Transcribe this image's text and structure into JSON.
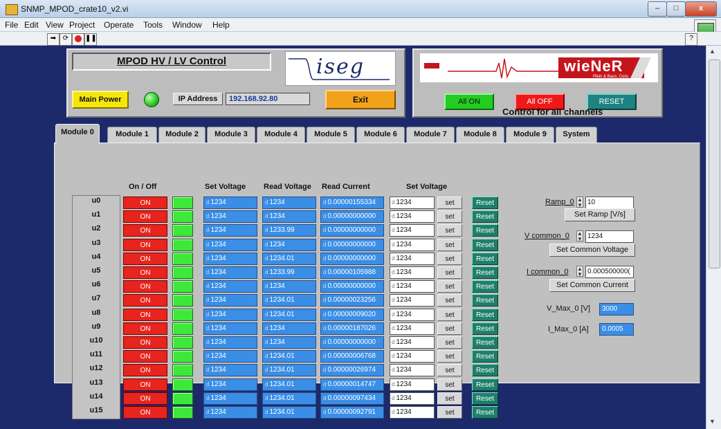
{
  "window": {
    "title": "SNMP_MPOD_crate10_v2.vi",
    "min": "–",
    "max": "□",
    "close": "x"
  },
  "menu": [
    "File",
    "Edit",
    "View",
    "Project",
    "Operate",
    "Tools",
    "Window",
    "Help"
  ],
  "toolbar": {
    "help": "?"
  },
  "header": {
    "title": "MPOD HV / LV Control",
    "iseg_logo": "iseg",
    "main_power": "Main Power",
    "ip_label": "IP Address",
    "ip_value": "192.168.92.80",
    "exit": "Exit"
  },
  "wiener": {
    "logo": "wieNeR",
    "sub": "Plein & Baus, Corp.",
    "all_on": "All ON",
    "all_off": "All OFF",
    "reset": "RESET",
    "caption": "Control for all channels"
  },
  "tabs": [
    "Module 0",
    "Module 1",
    "Module 2",
    "Module 3",
    "Module 4",
    "Module 5",
    "Module 6",
    "Module 7",
    "Module 8",
    "Module 9",
    "System"
  ],
  "columns": {
    "onoff": "On / Off",
    "set_voltage": "Set Voltage",
    "read_voltage": "Read Voltage",
    "read_current": "Read Current",
    "set_voltage2": "Set Voltage"
  },
  "channels": [
    {
      "name": "u0",
      "on": "ON",
      "set": "1234",
      "readv": "1234",
      "readi": "0.00000155334",
      "ctl": "1234",
      "setbtn": "set",
      "reset": "Reset"
    },
    {
      "name": "u1",
      "on": "ON",
      "set": "1234",
      "readv": "1234",
      "readi": "0.00000000000",
      "ctl": "1234",
      "setbtn": "set",
      "reset": "Reset"
    },
    {
      "name": "u2",
      "on": "ON",
      "set": "1234",
      "readv": "1233.99",
      "readi": "0.00000000000",
      "ctl": "1234",
      "setbtn": "set",
      "reset": "Reset"
    },
    {
      "name": "u3",
      "on": "ON",
      "set": "1234",
      "readv": "1234",
      "readi": "0.00000000000",
      "ctl": "1234",
      "setbtn": "set",
      "reset": "Reset"
    },
    {
      "name": "u4",
      "on": "ON",
      "set": "1234",
      "readv": "1234.01",
      "readi": "0.00000000000",
      "ctl": "1234",
      "setbtn": "set",
      "reset": "Reset"
    },
    {
      "name": "u5",
      "on": "ON",
      "set": "1234",
      "readv": "1233.99",
      "readi": "0.00000105988",
      "ctl": "1234",
      "setbtn": "set",
      "reset": "Reset"
    },
    {
      "name": "u6",
      "on": "ON",
      "set": "1234",
      "readv": "1234",
      "readi": "0.00000000000",
      "ctl": "1234",
      "setbtn": "set",
      "reset": "Reset"
    },
    {
      "name": "u7",
      "on": "ON",
      "set": "1234",
      "readv": "1234.01",
      "readi": "0.00000023256",
      "ctl": "1234",
      "setbtn": "set",
      "reset": "Reset"
    },
    {
      "name": "u8",
      "on": "ON",
      "set": "1234",
      "readv": "1234.01",
      "readi": "0.00000009020",
      "ctl": "1234",
      "setbtn": "set",
      "reset": "Reset"
    },
    {
      "name": "u9",
      "on": "ON",
      "set": "1234",
      "readv": "1234",
      "readi": "0.00000187026",
      "ctl": "1234",
      "setbtn": "set",
      "reset": "Reset"
    },
    {
      "name": "u10",
      "on": "ON",
      "set": "1234",
      "readv": "1234",
      "readi": "0.00000000000",
      "ctl": "1234",
      "setbtn": "set",
      "reset": "Reset"
    },
    {
      "name": "u11",
      "on": "ON",
      "set": "1234",
      "readv": "1234.01",
      "readi": "0.00000006768",
      "ctl": "1234",
      "setbtn": "set",
      "reset": "Reset"
    },
    {
      "name": "u12",
      "on": "ON",
      "set": "1234",
      "readv": "1234.01",
      "readi": "0.00000026974",
      "ctl": "1234",
      "setbtn": "set",
      "reset": "Reset"
    },
    {
      "name": "u13",
      "on": "ON",
      "set": "1234",
      "readv": "1234.01",
      "readi": "0.00000014747",
      "ctl": "1234",
      "setbtn": "set",
      "reset": "Reset"
    },
    {
      "name": "u14",
      "on": "ON",
      "set": "1234",
      "readv": "1234.01",
      "readi": "0.00000097434",
      "ctl": "1234",
      "setbtn": "set",
      "reset": "Reset"
    },
    {
      "name": "u15",
      "on": "ON",
      "set": "1234",
      "readv": "1234.01",
      "readi": "0.00000092791",
      "ctl": "1234",
      "setbtn": "set",
      "reset": "Reset"
    }
  ],
  "right": {
    "ramp_label": "Ramp_0",
    "ramp_value": "10",
    "set_ramp": "Set Ramp [V/s]",
    "vcommon_label": "V common_0",
    "vcommon_value": "1234",
    "set_common_voltage": "Set Common Voltage",
    "icommon_label": "I common_0",
    "icommon_value": "0.000500000(",
    "set_common_current": "Set Common Current",
    "vmax_label": "V_Max_0 [V]",
    "vmax_value": "3000",
    "imax_label": "I_Max_0 [A]",
    "imax_value": "0.0005"
  },
  "colors": {
    "panel_bg": "#1c2a6b",
    "tab_bg": "#c0c0c0",
    "on_red": "#e8241e",
    "led_green": "#3ee83a",
    "indicator_blue": "#3a8ee6",
    "reset_teal": "#1e7f6a"
  }
}
